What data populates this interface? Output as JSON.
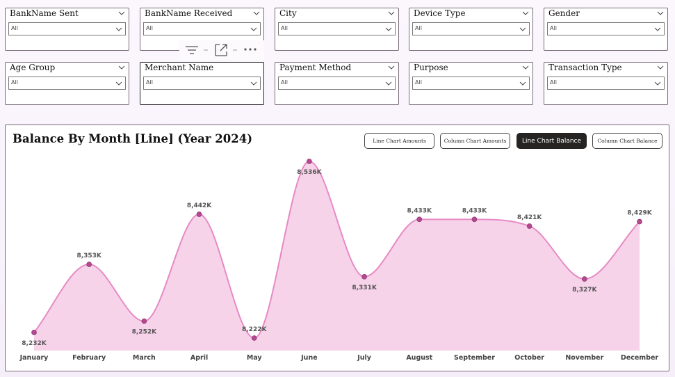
{
  "slicers": [
    {
      "title": "BankName Sent",
      "value": "All"
    },
    {
      "title": "BankName Received",
      "value": "All"
    },
    {
      "title": "City",
      "value": "All"
    },
    {
      "title": "Device Type",
      "value": "All"
    },
    {
      "title": "Gender",
      "value": "All"
    },
    {
      "title": "Age Group",
      "value": "All"
    },
    {
      "title": "Merchant Name",
      "value": "All"
    },
    {
      "title": "Payment Method",
      "value": "All"
    },
    {
      "title": "Purpose",
      "value": "All"
    },
    {
      "title": "Transaction Type",
      "value": "All"
    }
  ],
  "toolbar": {
    "filter_icon": "filter-icon",
    "focus_icon": "focus-mode-icon",
    "more_icon": "more-options-icon"
  },
  "chart": {
    "title": "Balance By Month [Line] (Year 2024)",
    "buttons": [
      {
        "label": "Line Chart Amounts",
        "active": false
      },
      {
        "label": "Column Chart Amounts",
        "active": false
      },
      {
        "label": "Line Chart Balance",
        "active": true
      },
      {
        "label": "Column Chart Balance",
        "active": false
      }
    ]
  },
  "colors": {
    "line": "#e68ac4",
    "area": "#f7d3ea",
    "marker": "#b5488f",
    "active_button": "#252423"
  },
  "chart_data": {
    "type": "area",
    "title": "Balance By Month [Line] (Year 2024)",
    "categories": [
      "January",
      "February",
      "March",
      "April",
      "May",
      "June",
      "July",
      "August",
      "September",
      "October",
      "November",
      "December"
    ],
    "values": [
      8232,
      8353,
      8252,
      8442,
      8222,
      8536,
      8331,
      8433,
      8433,
      8421,
      8327,
      8429
    ],
    "data_labels": [
      "8,232K",
      "8,353K",
      "8,252K",
      "8,442K",
      "8,222K",
      "8,536K",
      "8,331K",
      "8,433K",
      "8,433K",
      "8,421K",
      "8,327K",
      "8,429K"
    ],
    "unit": "K",
    "xlabel": "",
    "ylabel": "",
    "grid": false,
    "legend": "none"
  }
}
